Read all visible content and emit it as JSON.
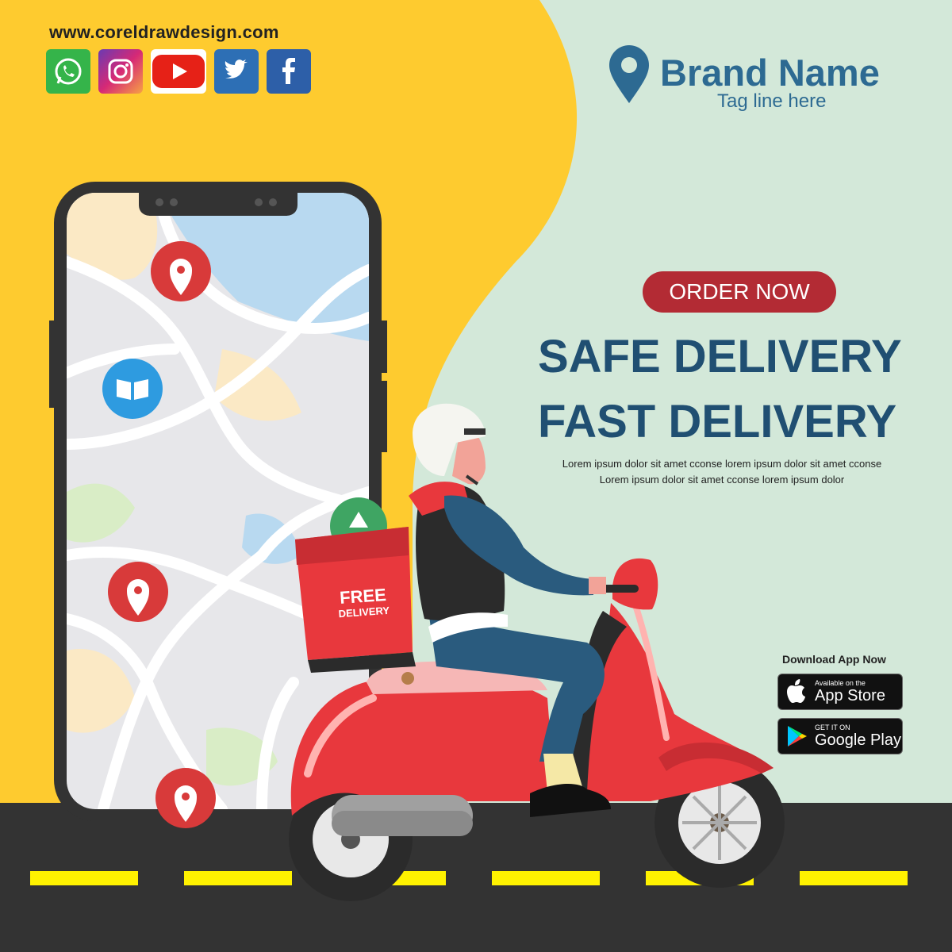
{
  "website": "www.coreldrawdesign.com",
  "social_icons": [
    "whatsapp-icon",
    "instagram-icon",
    "youtube-icon",
    "twitter-icon",
    "facebook-icon"
  ],
  "brand": {
    "name": "Brand Name",
    "tagline": "Tag line here"
  },
  "cta": {
    "order_label": "ORDER NOW"
  },
  "headline": {
    "line1": "SAFE DELIVERY",
    "line2": "FAST DELIVERY"
  },
  "body": {
    "line1": "Lorem ipsum dolor sit amet cconse lorem ipsum dolor sit amet cconse",
    "line2": "Lorem ipsum dolor sit amet cconse lorem ipsum dolor"
  },
  "box_label": {
    "line1": "FREE",
    "line2": "DELIVERY"
  },
  "download": {
    "title": "Download App Now",
    "appstore": {
      "small": "Available on the",
      "big": "App Store"
    },
    "googleplay": {
      "small": "GET IT ON",
      "big": "Google Play"
    }
  },
  "colors": {
    "yellow": "#fecb2f",
    "mint": "#d3e8d9",
    "navy": "#204f72",
    "brand_blue": "#2d6a92",
    "red": "#e8383d",
    "road": "#333333"
  }
}
